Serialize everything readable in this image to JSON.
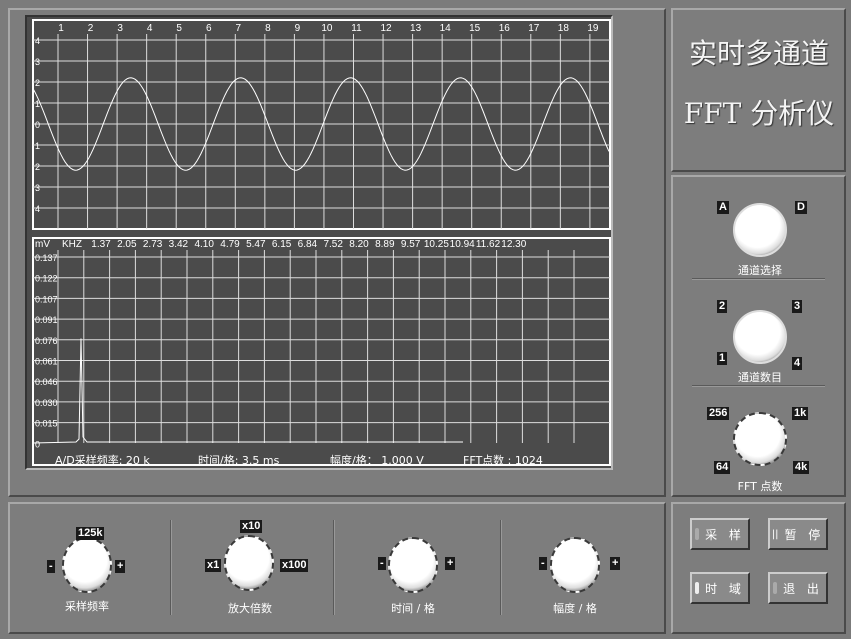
{
  "title": {
    "line1": "实时多通道",
    "line2": "FFT 分析仪"
  },
  "time_plot": {
    "x_labels": [
      "1",
      "2",
      "3",
      "4",
      "5",
      "6",
      "7",
      "8",
      "9",
      "10",
      "11",
      "12",
      "13",
      "14",
      "15",
      "16",
      "17",
      "18",
      "19"
    ],
    "y_labels": [
      "4",
      "3",
      "2",
      "1",
      "0",
      "1",
      "2",
      "3",
      "4"
    ],
    "amplitude": 2.2,
    "period_divisions": 3.72,
    "phase_deg": 130
  },
  "fft_plot": {
    "unit_y": "mV",
    "unit_x": "KHZ",
    "x_labels": [
      "1.37",
      "2.05",
      "2.73",
      "3.42",
      "4.10",
      "4.79",
      "5.47",
      "6.15",
      "6.84",
      "7.52",
      "8.20",
      "8.89",
      "9.57",
      "10.25",
      "10.94",
      "11.62",
      "12.30"
    ],
    "y_labels": [
      "0.137",
      "0.122",
      "0.107",
      "0.091",
      "0.076",
      "0.061",
      "0.046",
      "0.030",
      "0.015",
      "0"
    ],
    "peak_khz": 1.37,
    "peak_mv": 0.077
  },
  "status": {
    "sample_rate": "A/D采样频率:  20  k",
    "time_div": "时间/格:  3.5  ms",
    "amp_div": "幅度/格：  1.000  V",
    "fft_points": "FFT点数 : 1024"
  },
  "knobs": {
    "channel_select": {
      "label": "通道选择",
      "opts": [
        "A",
        "D"
      ]
    },
    "channel_count": {
      "label": "通道数目",
      "opts": [
        "2",
        "3",
        "1",
        "4"
      ]
    },
    "fft_points": {
      "label": "FFT 点数",
      "opts": [
        "256",
        "1k",
        "64",
        "4k"
      ]
    },
    "sample_rate": {
      "label": "采样频率",
      "top": "125k",
      "minus": "-",
      "plus": "+"
    },
    "gain": {
      "label": "放大倍数",
      "top": "x10",
      "left": "x1",
      "right": "x100"
    },
    "time_div": {
      "label": "时间 / 格",
      "minus": "-",
      "plus": "+"
    },
    "amp_div": {
      "label": "幅度 / 格",
      "minus": "-",
      "plus": "+"
    }
  },
  "buttons": {
    "sample": "采 样",
    "pause": "暂 停",
    "time_domain": "时 域",
    "exit": "退 出"
  }
}
